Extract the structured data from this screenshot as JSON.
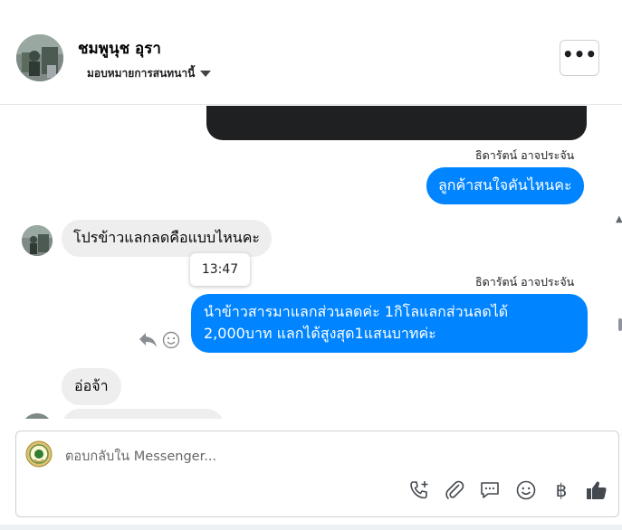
{
  "header": {
    "contact_name": "ชมพูนุช อุรา",
    "assign_label": "มอบหมายการสนทนานี้",
    "more_label": "•••"
  },
  "messages": [
    {
      "id": "m1",
      "direction": "out",
      "sender": "ธิดารัตน์ อาจประจัน",
      "text": "ลูกค้าสนใจคันไหนคะ"
    },
    {
      "id": "m2",
      "direction": "in",
      "text": "โปรข้าวแลกลดคือแบบไหนคะ",
      "tooltip_time": "13:47"
    },
    {
      "id": "m3",
      "direction": "out",
      "sender": "ธิดารัตน์ อาจประจัน",
      "lines": [
        "นำข้าวสารมาแลกส่วนลดค่ะ 1กิโลแลกส่วนลดได้",
        "2,000บาท แลกได้สูงสุด1แสนบาทค่ะ"
      ]
    },
    {
      "id": "m4",
      "direction": "in",
      "text": "อ่อจ้า"
    }
  ],
  "composer": {
    "placeholder": "ตอบกลับใน Messenger...",
    "baht_symbol": "฿",
    "tools": [
      "phone-plus-icon",
      "paperclip-icon",
      "chat-bubble-icon",
      "emoji-icon",
      "baht-icon",
      "thumbs-up-icon"
    ]
  },
  "colors": {
    "outgoing_bubble": "#0084ff",
    "incoming_bubble": "#eeeeee",
    "border": "#ccd0d5"
  }
}
